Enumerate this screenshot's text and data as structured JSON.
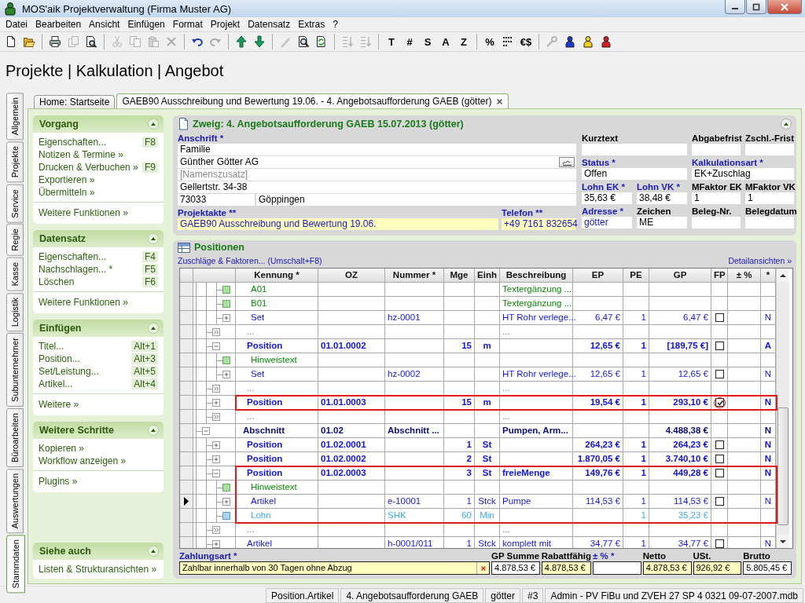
{
  "window": {
    "title": "MOS'aik Projektverwaltung (Firma Muster AG)"
  },
  "menu": [
    "Datei",
    "Bearbeiten",
    "Ansicht",
    "Einfügen",
    "Format",
    "Projekt",
    "Datensatz",
    "Extras",
    "?"
  ],
  "toolbar": [
    {
      "kind": "icon",
      "disabled": false
    },
    {
      "kind": "icon",
      "disabled": false
    },
    {
      "kind": "separator"
    },
    {
      "kind": "icon",
      "disabled": false
    },
    {
      "kind": "icon",
      "disabled": true
    },
    {
      "kind": "icon",
      "disabled": false
    },
    {
      "kind": "separator"
    },
    {
      "kind": "icon",
      "disabled": true
    },
    {
      "kind": "icon",
      "disabled": true
    },
    {
      "kind": "icon",
      "disabled": true
    },
    {
      "kind": "icon",
      "disabled": true
    },
    {
      "kind": "separator"
    },
    {
      "kind": "icon",
      "disabled": false
    },
    {
      "kind": "icon",
      "disabled": true
    },
    {
      "kind": "separator"
    },
    {
      "kind": "icon",
      "disabled": false
    },
    {
      "kind": "icon",
      "disabled": false
    },
    {
      "kind": "separator"
    },
    {
      "kind": "icon",
      "disabled": true
    },
    {
      "kind": "icon",
      "disabled": false
    },
    {
      "kind": "icon",
      "disabled": false
    },
    {
      "kind": "separator"
    },
    {
      "kind": "icon",
      "disabled": true
    },
    {
      "kind": "icon",
      "disabled": true
    },
    {
      "kind": "separator"
    },
    {
      "kind": "text",
      "label": "T",
      "disabled": false
    },
    {
      "kind": "text",
      "label": "#",
      "disabled": false
    },
    {
      "kind": "text",
      "label": "S",
      "disabled": false
    },
    {
      "kind": "text",
      "label": "A",
      "disabled": false
    },
    {
      "kind": "text",
      "label": "Z",
      "disabled": false
    },
    {
      "kind": "separator"
    },
    {
      "kind": "text",
      "label": "%",
      "disabled": false
    },
    {
      "kind": "icon",
      "disabled": false
    },
    {
      "kind": "text",
      "label": "€$",
      "disabled": false
    },
    {
      "kind": "separator"
    },
    {
      "kind": "icon",
      "disabled": true
    },
    {
      "kind": "icon",
      "disabled": false
    },
    {
      "kind": "icon",
      "disabled": false
    },
    {
      "kind": "icon",
      "disabled": false
    }
  ],
  "heading": "Projekte | Kalkulation | Angebot",
  "side_tabs": [
    {
      "label": "Allgemein",
      "selected": false
    },
    {
      "label": "Projekte",
      "selected": false
    },
    {
      "label": "Service",
      "selected": false
    },
    {
      "label": "Regie",
      "selected": false
    },
    {
      "label": "Kasse",
      "selected": false
    },
    {
      "label": "Logistik",
      "selected": false
    },
    {
      "label": "Subunternehmer",
      "selected": false
    },
    {
      "label": "Büroarbeiten",
      "selected": false
    },
    {
      "label": "Auswertungen",
      "selected": false
    },
    {
      "label": "Stammdaten",
      "selected": true
    }
  ],
  "doc_tabs": [
    {
      "label": "Home: Startseite",
      "selected": false
    },
    {
      "label": "GAEB90 Ausschreibung und Bewertung 19.06. - 4. Angebotsaufforderung GAEB (götter)",
      "selected": true
    }
  ],
  "task_panel": {
    "sections": [
      {
        "title": "Vorgang",
        "expanded": true,
        "items": [
          {
            "label": "Eigenschaften...",
            "shortcut": "F8"
          },
          {
            "label": "Notizen & Termine »"
          },
          {
            "label": "Drucken & Verbuchen »",
            "shortcut": "F9"
          },
          {
            "label": "Exportieren »"
          },
          {
            "label": "Übermitteln »"
          }
        ],
        "more": [
          "Weitere Funktionen »"
        ]
      },
      {
        "title": "Datensatz",
        "expanded": true,
        "items": [
          {
            "label": "Eigenschaften...",
            "shortcut": "F4"
          },
          {
            "label": "Nachschlagen... *",
            "shortcut": "F5"
          },
          {
            "label": "Löschen",
            "shortcut": "F6"
          }
        ],
        "more": [
          "Weitere Funktionen »"
        ]
      },
      {
        "title": "Einfügen",
        "expanded": true,
        "items": [
          {
            "label": "Titel...",
            "shortcut": "Alt+1"
          },
          {
            "label": "Position...",
            "shortcut": "Alt+3"
          },
          {
            "label": "Set/Leistung...",
            "shortcut": "Alt+5"
          },
          {
            "label": "Artikel...",
            "shortcut": "Alt+4"
          }
        ],
        "more": [
          "Weitere »"
        ]
      },
      {
        "title": "Weitere Schritte",
        "expanded": true,
        "items": [
          {
            "label": "Kopieren »"
          },
          {
            "label": "Workflow anzeigen »"
          }
        ],
        "more": [
          "Plugins »"
        ]
      },
      {
        "title": "Siehe auch",
        "expanded": true,
        "items": [
          {
            "label": "Listen & Strukturansichten »"
          }
        ]
      }
    ]
  },
  "branch": {
    "title": "Zweig: 4. Angebotsaufforderung GAEB 15.07.2013 (götter)",
    "expanded": true,
    "address": {
      "label": "Anschrift *",
      "required": true,
      "lines": [
        {
          "value": "Familie"
        },
        {
          "value": "Günther Götter AG",
          "kind": "lookup"
        },
        {
          "placeholder": "[Namenszusatz]"
        },
        {
          "value": "Gellertstr. 34-38"
        },
        {
          "zip": "73033",
          "city": "Göppingen"
        }
      ]
    },
    "project_file": {
      "label": "Projektakte **",
      "required": true,
      "value": "GAEB90 Ausschreibung und Bewertung 19.06.",
      "kind": "link",
      "highlighted": true
    },
    "phone": {
      "label": "Telefon **",
      "required": true,
      "value": "+49 7161 832654",
      "kind": "link",
      "highlighted": true
    },
    "field_rows": [
      [
        {
          "label": "Kurztext",
          "required": false,
          "kind": "text"
        },
        {
          "label": "Abgabefrist",
          "required": false,
          "kind": "text"
        },
        {
          "label": "Zschl.-Frist",
          "required": false,
          "kind": "text"
        }
      ],
      [
        {
          "label": "Status *",
          "required": true,
          "value": "Offen",
          "kind": "text"
        },
        {
          "label": "Kalkulationsart *",
          "required": true,
          "value": "EK+Zuschlag",
          "kind": "text"
        }
      ],
      [
        {
          "label": "Lohn EK *",
          "required": true,
          "value": "35,63 €",
          "kind": "text"
        },
        {
          "label": "Lohn VK *",
          "required": true,
          "value": "38,48 €",
          "kind": "text"
        },
        {
          "label": "MFaktor EK",
          "required": false,
          "value": "1",
          "kind": "text"
        },
        {
          "label": "MFaktor VK",
          "required": false,
          "value": "1",
          "kind": "text"
        }
      ],
      [
        {
          "label": "Adresse *",
          "required": true,
          "value": "götter",
          "kind": "link"
        },
        {
          "label": "Zeichen",
          "required": false,
          "value": "ME",
          "kind": "text"
        },
        {
          "label": "Beleg-Nr.",
          "required": false,
          "kind": "text"
        },
        {
          "label": "Belegdatum",
          "required": false,
          "kind": "text"
        }
      ]
    ]
  },
  "positions": {
    "title": "Positionen",
    "links": [
      "Zuschläge & Faktoren... (Umschalt+F8)",
      "Detailansichten »"
    ],
    "table": {
      "columns": [
        "Kennung *",
        "OZ",
        "Nummer *",
        "Mge",
        "Einh",
        "Beschreibung",
        "EP",
        "PE",
        "GP",
        "FP",
        "± %",
        "*"
      ],
      "rows": [
        {
          "children": [
            {
              "children": [
                {
                  "kind": "note",
                  "kennung": "A01",
                  "beschreibung": "Textergänzung ...",
                  "selected": false,
                  "marked": false
                },
                {
                  "kind": "note",
                  "kennung": "B01",
                  "beschreibung": "Textergänzung ...",
                  "selected": false,
                  "marked": false
                },
                {
                  "kind": "item",
                  "kennung": "Set",
                  "nummer": "hz-0001",
                  "beschreibung": "HT Rohr verlege...",
                  "ep": "6,47 €",
                  "pe": "1",
                  "gp": "6,47 €",
                  "fp": false,
                  "flag": "N",
                  "expanded": false,
                  "selected": false,
                  "marked": false
                }
              ]
            },
            {
              "kind": "more",
              "kennung": "...",
              "beschreibung": "...",
              "selected": false,
              "marked": false
            },
            {
              "kind": "position",
              "kennung": "Position",
              "oz": "01.01.0002",
              "mge": "15",
              "einh": "m",
              "ep": "12,65 €",
              "pe": "1",
              "gp": "[189,75 €]",
              "fp": false,
              "flag": "A",
              "expanded": true,
              "selected": false,
              "marked": false,
              "children": [
                {
                  "kind": "note",
                  "kennung": "Hinweistext",
                  "selected": false,
                  "marked": false
                },
                {
                  "kind": "item",
                  "kennung": "Set",
                  "nummer": "hz-0002",
                  "beschreibung": "HT Rohr verlege...",
                  "ep": "12,65 €",
                  "pe": "1",
                  "gp": "12,65 €",
                  "fp": false,
                  "flag": "N",
                  "expanded": false,
                  "selected": false,
                  "marked": false
                }
              ]
            },
            {
              "kind": "more",
              "kennung": "...",
              "beschreibung": "...",
              "selected": false,
              "marked": false
            },
            {
              "kind": "position",
              "kennung": "Position",
              "oz": "01.01.0003",
              "mge": "15",
              "einh": "m",
              "ep": "19,54 €",
              "pe": "1",
              "gp": "293,10 €",
              "fp": true,
              "fp_circled": true,
              "flag": "N",
              "expanded": false,
              "selected": false,
              "marked": true
            },
            {
              "kind": "more",
              "kennung": "...",
              "beschreibung": "...",
              "selected": false,
              "marked": false
            }
          ]
        },
        {
          "kind": "section",
          "kennung": "Abschnitt",
          "oz": "01.02",
          "nummer": "Abschnitt ...",
          "beschreibung": "Pumpen, Arm...",
          "gp": "4.488,38 €",
          "flag": "N",
          "expanded": true,
          "selected": false,
          "marked": false,
          "children": [
            {
              "kind": "position",
              "kennung": "Position",
              "oz": "01.02.0001",
              "mge": "1",
              "einh": "St",
              "ep": "264,23 €",
              "pe": "1",
              "gp": "264,23 €",
              "fp": false,
              "flag": "N",
              "expanded": false,
              "selected": false,
              "marked": false
            },
            {
              "kind": "position",
              "kennung": "Position",
              "oz": "01.02.0002",
              "mge": "2",
              "einh": "St",
              "ep": "1.870,05 €",
              "pe": "1",
              "gp": "3.740,10 €",
              "fp": false,
              "flag": "N",
              "expanded": false,
              "selected": false,
              "marked": false
            },
            {
              "kind": "position",
              "kennung": "Position",
              "oz": "01.02.0003",
              "mge": "3",
              "einh": "St",
              "beschreibung": "freieMenge",
              "ep": "149,76 €",
              "pe": "1",
              "gp": "449,28 €",
              "fp": false,
              "flag": "N",
              "expanded": true,
              "selected": false,
              "marked": true,
              "children": [
                {
                  "kind": "note",
                  "kennung": "Hinweistext",
                  "selected": false,
                  "marked": true
                },
                {
                  "kind": "item",
                  "kennung": "Artikel",
                  "nummer": "e-10001",
                  "mge": "1",
                  "einh": "Stck",
                  "beschreibung": "Pumpe",
                  "ep": "114,53 €",
                  "pe": "1",
                  "gp": "114,53 €",
                  "fp": false,
                  "flag": "N",
                  "expanded": false,
                  "selected": true,
                  "marked": true
                },
                {
                  "kind": "wage",
                  "kennung": "Lohn",
                  "nummer": "SHK",
                  "mge": "60",
                  "einh": "Min",
                  "pe": "1",
                  "gp": "35,23 €",
                  "selected": false,
                  "marked": true
                }
              ]
            },
            {
              "kind": "more",
              "kennung": "...",
              "beschreibung": "...",
              "selected": false,
              "marked": false
            },
            {
              "kind": "item",
              "kennung": "Artikel",
              "nummer": "h-0001/011",
              "mge": "1",
              "einh": "Stck",
              "beschreibung": "komplett mit",
              "ep": "34,77 €",
              "pe": "1",
              "gp": "34,77 €",
              "fp": false,
              "flag": "N",
              "expanded": false,
              "selected": false,
              "marked": false
            }
          ]
        }
      ]
    },
    "footer": {
      "payment": {
        "label": "Zahlungsart *",
        "required": true,
        "value": "Zahlbar innerhalb von 30 Tagen ohne Abzug"
      },
      "totals": [
        {
          "label": "GP Summe",
          "required": false,
          "value": "4.878,53 €",
          "highlighted": false
        },
        {
          "label": "Rabattfähig",
          "required": false,
          "value": "4.878,53 €",
          "highlighted": true
        },
        {
          "label": "± % *",
          "required": true,
          "highlighted": false
        },
        {
          "label": "Netto",
          "required": false,
          "value": "4.878,53 €",
          "highlighted": true
        },
        {
          "label": "USt.",
          "required": false,
          "value": "926,92 €",
          "highlighted": true
        },
        {
          "label": "Brutto",
          "required": false,
          "value": "5.805,45 €",
          "highlighted": false
        }
      ]
    }
  },
  "status_bar": [
    "Position.Artikel",
    "4. Angebotsaufforderung GAEB",
    "götter",
    "#3",
    "Admin - PV FiBu und ZVEH 27 SP 4 0321 09-07-2007.mdb"
  ]
}
